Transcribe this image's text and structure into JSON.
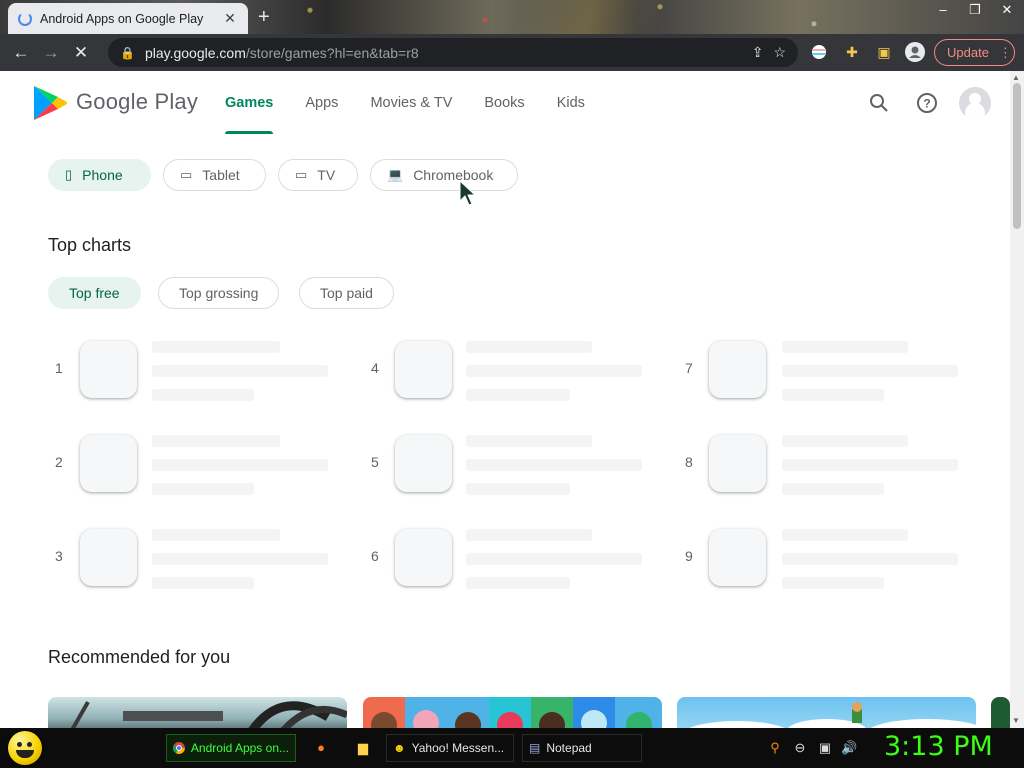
{
  "browser": {
    "tab_title": "Android Apps on Google Play",
    "url_host": "play.google.com",
    "url_path": "/store/games?hl=en&tab=r8",
    "update_label": "Update"
  },
  "header": {
    "brand": "Google Play",
    "nav": [
      "Games",
      "Apps",
      "Movies & TV",
      "Books",
      "Kids"
    ]
  },
  "devices": [
    "Phone",
    "Tablet",
    "TV",
    "Chromebook"
  ],
  "top_charts": {
    "title": "Top charts",
    "filters": [
      "Top free",
      "Top grossing",
      "Top paid"
    ],
    "ranks": [
      "1",
      "2",
      "3",
      "4",
      "5",
      "6",
      "7",
      "8",
      "9"
    ]
  },
  "recommended": {
    "title": "Recommended for you"
  },
  "taskbar": {
    "items": [
      "Android Apps on...",
      "Yahoo! Messen...",
      "Notepad"
    ],
    "clock": "3:13 PM"
  },
  "colors": {
    "accent": "#01875f",
    "update": "#f28b82",
    "clock": "#39ff14"
  }
}
